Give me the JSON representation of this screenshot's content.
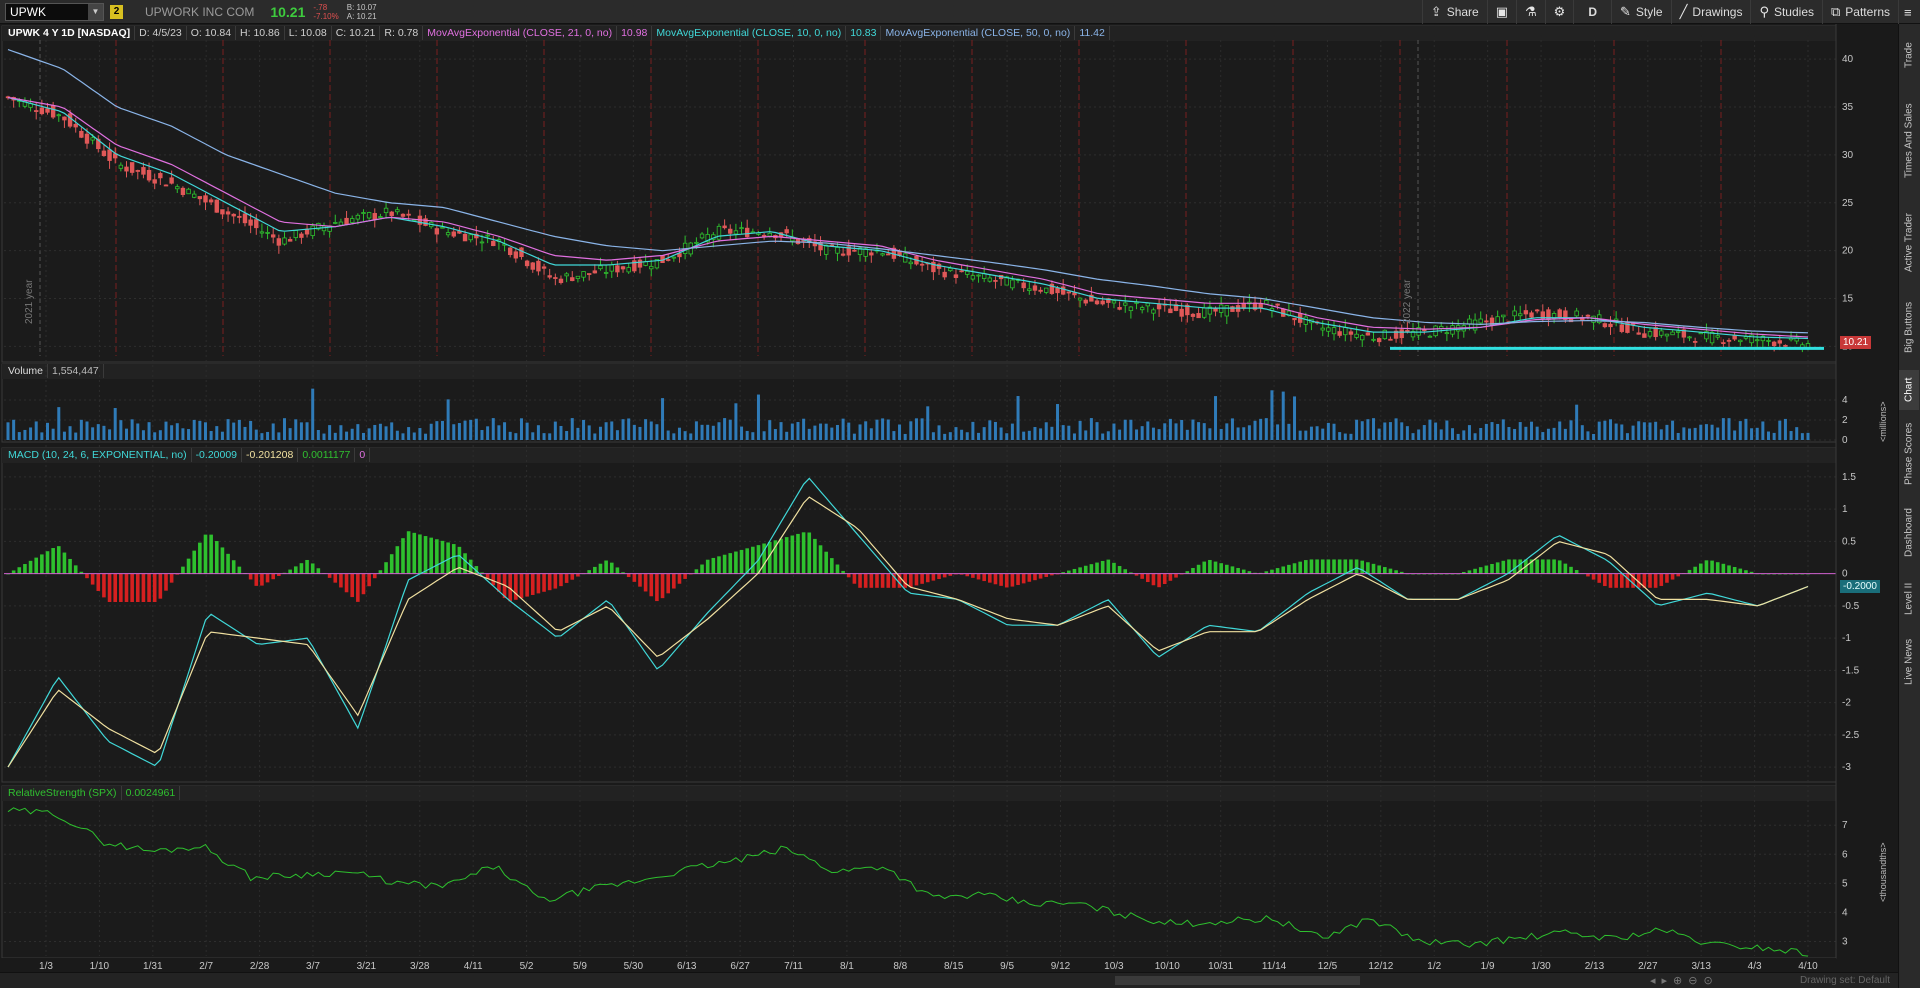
{
  "toolbar": {
    "symbol": "UPWK",
    "link_badge": "2",
    "company": "UPWORK INC COM",
    "last": "10.21",
    "change": "-.78",
    "change_pct": "-7.10%",
    "bid": "B: 10.07",
    "ask": "A: 10.21",
    "buttons": [
      "Share",
      "Drawings",
      "Studies",
      "Patterns",
      "Style"
    ],
    "aggregation": "D"
  },
  "sidebar": {
    "tabs": [
      "Trade",
      "Times And Sales",
      "Active Trader",
      "Big Buttons",
      "Chart",
      "Phase Scores",
      "Dashboard",
      "Level II",
      "Live News"
    ]
  },
  "price_panel": {
    "title": "UPWK 4 Y 1D [NASDAQ]",
    "date": "D: 4/5/23",
    "open": "O: 10.84",
    "high": "H: 10.86",
    "low": "L: 10.08",
    "close": "C: 10.21",
    "range": "R: 0.78",
    "ema21_label": "MovAvgExponential (CLOSE, 21, 0, no)",
    "ema21_val": "10.98",
    "ema10_label": "MovAvgExponential (CLOSE, 10, 0, no)",
    "ema10_val": "10.83",
    "ema50_label": "MovAvgExponential (CLOSE, 50, 0, no)",
    "ema50_val": "11.42",
    "last_tag": "10.21",
    "year_labels": [
      "2021 year",
      "2022 year"
    ]
  },
  "volume_panel": {
    "title": "Volume",
    "value": "1,554,447",
    "unit": "<millions>"
  },
  "macd_panel": {
    "title": "MACD (10, 24, 6, EXPONENTIAL, no)",
    "value": "-0.20009",
    "avg": "-0.201208",
    "diff": "0.0011177",
    "zero": "0",
    "last_tag": "-0.2000"
  },
  "rs_panel": {
    "title": "RelativeStrength (SPX)",
    "value": "0.0024961",
    "unit": "<thousandths>"
  },
  "bottom": {
    "drawing_set": "Drawing set: Default"
  },
  "chart_data": [
    {
      "type": "line",
      "name": "price",
      "x": [
        "1/3",
        "1/10",
        "1/31",
        "2/7",
        "2/28",
        "3/7",
        "3/21",
        "3/28",
        "4/11",
        "5/2",
        "5/9",
        "5/30",
        "6/13",
        "6/27",
        "7/11",
        "8/1",
        "8/8",
        "8/15",
        "9/5",
        "9/12",
        "10/3",
        "10/10",
        "10/31",
        "11/14",
        "12/5",
        "12/12",
        "1/2",
        "1/9",
        "1/30",
        "2/13",
        "2/27",
        "3/13",
        "4/3",
        "4/10"
      ],
      "ylim": [
        9,
        42
      ],
      "yticks": [
        10,
        15,
        20,
        25,
        30,
        35,
        40
      ],
      "series": [
        {
          "values": [
            36,
            34,
            29,
            27,
            24,
            21,
            23,
            24,
            22,
            21,
            17,
            18,
            19,
            22,
            22,
            20,
            20,
            18,
            17,
            16,
            14.5,
            14,
            13.5,
            14.5,
            12,
            11,
            11.5,
            12.5,
            13.5,
            13,
            11.5,
            11,
            10.8,
            10.21
          ]
        },
        {
          "values": [
            36,
            34.5,
            30,
            28,
            25,
            22,
            22.5,
            23.5,
            22.5,
            21,
            18.5,
            18.5,
            19,
            21.5,
            22,
            20.5,
            20,
            18.5,
            17.5,
            16.5,
            15,
            14.5,
            14,
            14,
            12.5,
            11.5,
            11.5,
            12,
            13,
            13,
            12,
            11.5,
            11,
            10.83
          ]
        },
        {
          "values": [
            36,
            35,
            31,
            29,
            26,
            23,
            22.5,
            23.5,
            23,
            21.5,
            19.5,
            19,
            19.5,
            21,
            21.5,
            21,
            20.5,
            19,
            18,
            17,
            15.5,
            15,
            14.5,
            14.5,
            13,
            12,
            11.8,
            12,
            12.8,
            13,
            12.3,
            11.8,
            11.3,
            10.98
          ]
        },
        {
          "values": [
            41,
            39,
            35,
            33,
            30,
            28,
            26,
            25,
            24.5,
            23,
            21.5,
            20.5,
            20,
            20.5,
            21,
            20.8,
            20.2,
            19.5,
            18.8,
            18,
            17,
            16.3,
            15.5,
            15,
            14,
            13,
            12.5,
            12.3,
            12.6,
            12.7,
            12.5,
            12,
            11.6,
            11.42
          ]
        }
      ]
    },
    {
      "type": "bar",
      "name": "volume",
      "yticks": [
        0,
        2,
        4
      ],
      "ylim": [
        0,
        6
      ]
    },
    {
      "type": "line",
      "name": "macd",
      "ylim": [
        -3.2,
        1.7
      ],
      "yticks": [
        1.5,
        1,
        0.5,
        0,
        -0.5,
        -1,
        -1.5,
        -2,
        -2.5,
        -3
      ],
      "series": [
        {
          "values": [
            -3,
            -1.6,
            -2.6,
            -3,
            -0.6,
            -1.1,
            -1.0,
            -2.4,
            -0.1,
            0.3,
            -0.4,
            -1.0,
            -0.4,
            -1.5,
            -0.6,
            0.2,
            1.5,
            0.6,
            -0.3,
            -0.4,
            -0.8,
            -0.8,
            -0.4,
            -1.3,
            -0.8,
            -0.9,
            -0.3,
            0.1,
            -0.4,
            -0.4,
            0.0,
            0.6,
            0.2,
            -0.5,
            -0.3,
            -0.5,
            -0.2
          ]
        },
        {
          "values": [
            -3,
            -1.8,
            -2.4,
            -2.8,
            -0.9,
            -1.0,
            -1.1,
            -2.2,
            -0.4,
            0.1,
            -0.2,
            -0.9,
            -0.5,
            -1.3,
            -0.7,
            0.0,
            1.2,
            0.7,
            -0.2,
            -0.4,
            -0.7,
            -0.8,
            -0.5,
            -1.2,
            -0.9,
            -0.9,
            -0.4,
            0.0,
            -0.4,
            -0.4,
            -0.1,
            0.5,
            0.3,
            -0.4,
            -0.4,
            -0.5,
            -0.2
          ]
        }
      ]
    },
    {
      "type": "line",
      "name": "relative_strength",
      "ylim": [
        2.5,
        7.8
      ],
      "yticks": [
        3,
        4,
        5,
        6,
        7
      ],
      "series": [
        {
          "values": [
            7.5,
            7.4,
            6.4,
            6.1,
            6.3,
            5.2,
            5.3,
            5.4,
            5.0,
            4.9,
            5.6,
            4.4,
            4.8,
            5.1,
            5.5,
            5.8,
            6.2,
            5.4,
            5.6,
            4.5,
            4.6,
            4.3,
            4.3,
            3.9,
            3.6,
            3.7,
            3.8,
            3.1,
            3.8,
            3.0,
            2.9,
            3.1,
            3.3,
            3.1,
            3.4,
            2.9,
            2.8,
            2.6
          ]
        }
      ]
    }
  ]
}
